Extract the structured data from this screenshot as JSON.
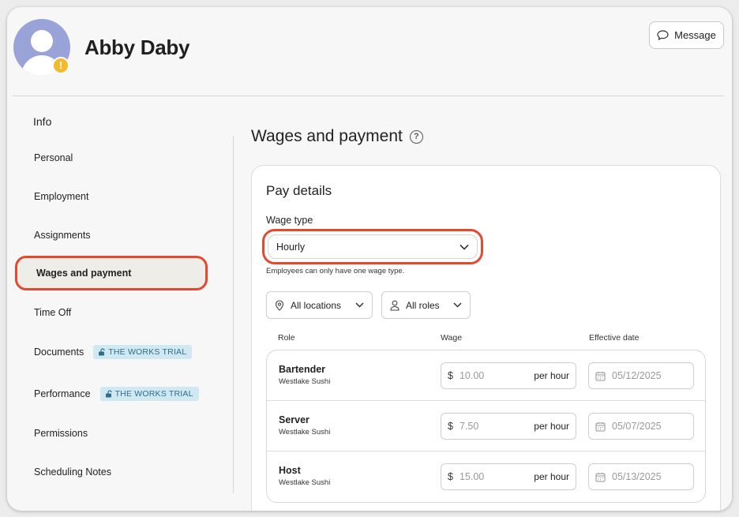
{
  "header": {
    "user_name": "Abby Daby",
    "warning_badge": "!",
    "message_button": "Message"
  },
  "sidebar": {
    "heading": "Info",
    "items": [
      {
        "label": "Personal"
      },
      {
        "label": "Employment"
      },
      {
        "label": "Assignments"
      },
      {
        "label": "Wages and payment",
        "active": true
      },
      {
        "label": "Time Off"
      },
      {
        "label": "Documents",
        "badge": "THE WORKS TRIAL"
      },
      {
        "label": "Performance",
        "badge": "THE WORKS TRIAL"
      },
      {
        "label": "Permissions"
      },
      {
        "label": "Scheduling Notes"
      }
    ]
  },
  "main": {
    "title": "Wages and payment",
    "help_icon_text": "?",
    "pay_details": {
      "title": "Pay details",
      "wage_type_label": "Wage type",
      "wage_type_value": "Hourly",
      "wage_type_hint": "Employees can only have one wage type.",
      "filters": {
        "locations": "All locations",
        "roles": "All roles"
      },
      "columns": {
        "role": "Role",
        "wage": "Wage",
        "effective_date": "Effective date"
      },
      "rows": [
        {
          "role": "Bartender",
          "location": "Westlake Sushi",
          "currency": "$",
          "wage": "10.00",
          "unit": "per hour",
          "date": "05/12/2025"
        },
        {
          "role": "Server",
          "location": "Westlake Sushi",
          "currency": "$",
          "wage": "7.50",
          "unit": "per hour",
          "date": "05/07/2025"
        },
        {
          "role": "Host",
          "location": "Westlake Sushi",
          "currency": "$",
          "wage": "15.00",
          "unit": "per hour",
          "date": "05/13/2025"
        }
      ]
    }
  },
  "colors": {
    "highlight": "#e14a30",
    "badge_bg": "#cfe8f1",
    "badge_text": "#2f6e8b",
    "avatar": "#9aa3d8",
    "warning": "#f5b92e"
  }
}
